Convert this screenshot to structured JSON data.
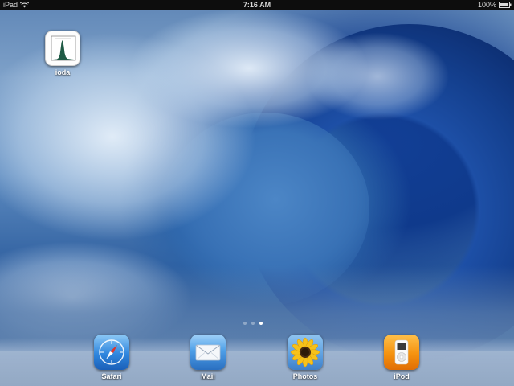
{
  "status_bar": {
    "device": "iPad",
    "time": "7:16 AM",
    "battery": "100%"
  },
  "home_apps": [
    {
      "label": "ioda",
      "icon": "histogram-chart-icon"
    }
  ],
  "page_indicator": {
    "count": 3,
    "active": 3
  },
  "dock_apps": [
    {
      "label": "Safari",
      "icon": "compass-icon"
    },
    {
      "label": "Mail",
      "icon": "envelope-icon"
    },
    {
      "label": "Photos",
      "icon": "sunflower-icon"
    },
    {
      "label": "iPod",
      "icon": "ipod-icon"
    }
  ],
  "colors": {
    "status_bar_bg": "#0d0d0d",
    "dock_icon_safari": "#3a8fe0",
    "dock_icon_ipod": "#f08a12"
  }
}
